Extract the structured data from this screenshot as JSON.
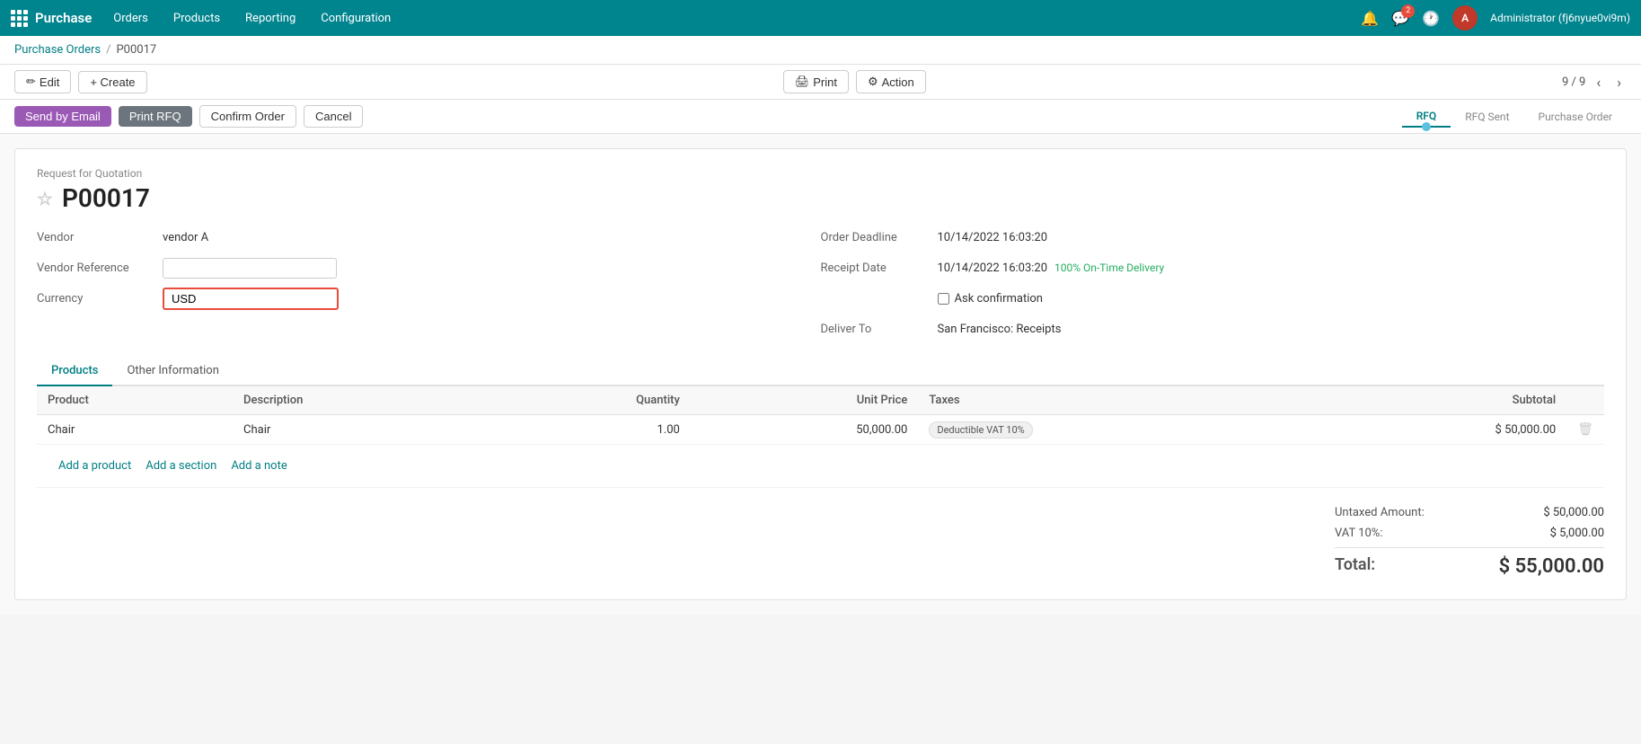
{
  "navbar": {
    "app_name": "Purchase",
    "nav_items": [
      "Orders",
      "Products",
      "Reporting",
      "Configuration"
    ],
    "user_name": "Administrator (fj6nyue0vi9m)",
    "user_initials": "A",
    "badge_count": "2"
  },
  "breadcrumb": {
    "parent": "Purchase Orders",
    "current": "P00017"
  },
  "action_bar": {
    "edit_label": "Edit",
    "create_label": "+ Create",
    "print_label": "Print",
    "action_label": "Action",
    "pagination": "9 / 9"
  },
  "status_bar": {
    "send_email_label": "Send by Email",
    "print_rfq_label": "Print RFQ",
    "confirm_order_label": "Confirm Order",
    "cancel_label": "Cancel",
    "steps": [
      "RFQ",
      "RFQ Sent",
      "Purchase Order"
    ],
    "active_step": "RFQ"
  },
  "form": {
    "record_label": "Request for Quotation",
    "record_id": "P00017",
    "vendor_label": "Vendor",
    "vendor_value": "vendor A",
    "vendor_ref_label": "Vendor Reference",
    "vendor_ref_value": "",
    "currency_label": "Currency",
    "currency_value": "USD",
    "order_deadline_label": "Order Deadline",
    "order_deadline_value": "10/14/2022 16:03:20",
    "receipt_date_label": "Receipt Date",
    "receipt_date_value": "10/14/2022 16:03:20",
    "on_time_label": "100% On-Time Delivery",
    "ask_confirmation_label": "Ask confirmation",
    "deliver_to_label": "Deliver To",
    "deliver_to_value": "San Francisco: Receipts"
  },
  "tabs": [
    "Products",
    "Other Information"
  ],
  "table": {
    "headers": [
      "Product",
      "Description",
      "Quantity",
      "Unit Price",
      "Taxes",
      "Subtotal"
    ],
    "rows": [
      {
        "product": "Chair",
        "description": "Chair",
        "quantity": "1.00",
        "unit_price": "50,000.00",
        "tax": "Deductible VAT 10%",
        "subtotal": "$ 50,000.00"
      }
    ],
    "add_product": "Add a product",
    "add_section": "Add a section",
    "add_note": "Add a note"
  },
  "totals": {
    "untaxed_label": "Untaxed Amount:",
    "untaxed_value": "$ 50,000.00",
    "vat_label": "VAT 10%:",
    "vat_value": "$ 5,000.00",
    "total_label": "Total:",
    "total_value": "$ 55,000.00"
  }
}
